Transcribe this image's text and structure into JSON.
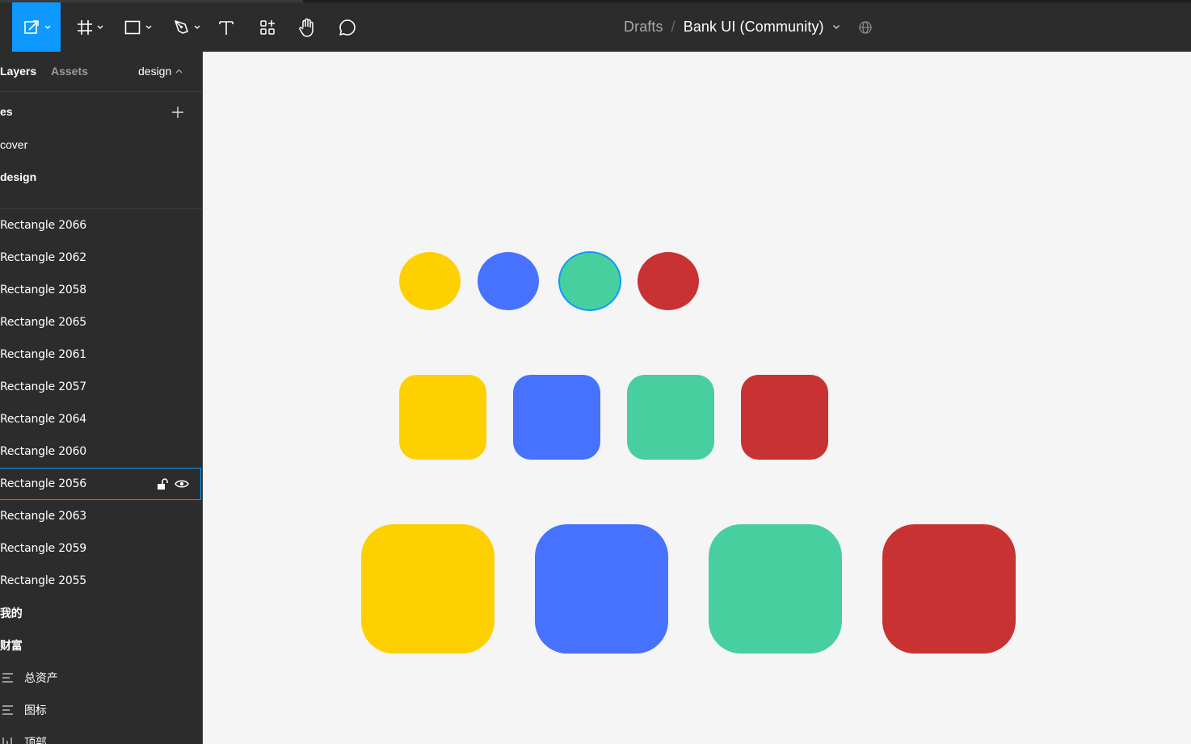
{
  "toolbar": {
    "breadcrumb_parent": "Drafts",
    "separator": "/",
    "file_name": "Bank UI (Community)",
    "tools": [
      "move-tool",
      "frame-tool",
      "shape-tool",
      "pen-tool",
      "text-tool",
      "resources-tool",
      "hand-tool",
      "comment-tool"
    ]
  },
  "panel": {
    "tab_layers": "Layers",
    "tab_assets": "Assets",
    "current_page": "design",
    "pages_header": "es",
    "pages": [
      "cover",
      "design"
    ],
    "layers": [
      {
        "label": "Rectangle 2066"
      },
      {
        "label": "Rectangle 2062"
      },
      {
        "label": "Rectangle 2058"
      },
      {
        "label": "Rectangle 2065"
      },
      {
        "label": "Rectangle 2061"
      },
      {
        "label": "Rectangle 2057"
      },
      {
        "label": "Rectangle 2064"
      },
      {
        "label": "Rectangle 2060"
      },
      {
        "label": "Rectangle 2056"
      },
      {
        "label": "Rectangle 2063"
      },
      {
        "label": "Rectangle 2059"
      },
      {
        "label": "Rectangle 2055"
      },
      {
        "label": "我的"
      },
      {
        "label": "财富"
      },
      {
        "label": "总资产"
      },
      {
        "label": "图标"
      },
      {
        "label": "顶部"
      }
    ]
  },
  "canvas": {
    "colors": {
      "yellow": "#ffd000",
      "blue": "#4672ff",
      "green": "#47cfa0",
      "red": "#c83232",
      "selection": "#0d99ff"
    },
    "selected_layer": "Rectangle 2056"
  }
}
